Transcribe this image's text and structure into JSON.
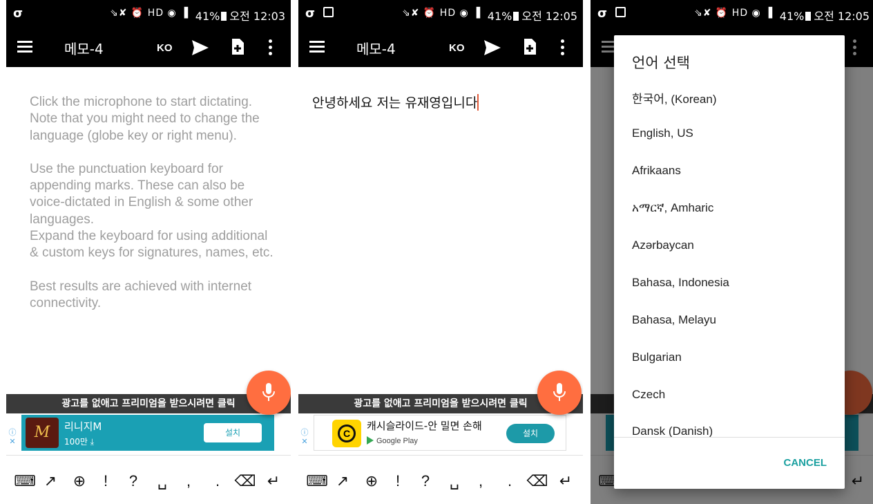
{
  "status_bar": {
    "icons": "⇘✘ ⏰ HD ◉ ▐",
    "battery": "41%",
    "time_1": "오전 12:03",
    "time_2": "오전 12:05",
    "time_3": "오전 12:05"
  },
  "toolbar": {
    "title": "메모-4",
    "lang_code": "KO"
  },
  "screen1": {
    "hint_paragraphs": [
      "Click the microphone to start dictating.\nNote that you might need to change the language (globe key or right menu).",
      "Use the punctuation keyboard for appending marks. These can also be voice-dictated in English & some other languages.\nExpand the keyboard for using additional & custom keys for signatures, names, etc.",
      "Best results are achieved with internet connectivity."
    ]
  },
  "screen2": {
    "dictated_text": "안녕하세요 저는 유재영입니다"
  },
  "ad": {
    "banner_text": "광고를 없애고 프리미엄을 받으시려면 클릭",
    "ad1_name": "리니지M",
    "ad1_sub": "100만 ⤓",
    "ad1_install": "설치",
    "ad1_logo": "M",
    "ad2_name": "캐시슬라이드-안 밀면 손해",
    "ad2_sub": "Google Play",
    "ad2_install": "설치",
    "ad2_logo": "C"
  },
  "keyboard": {
    "keys": [
      "⌨",
      "↗",
      "⊕",
      "!",
      "?",
      "␣",
      ",",
      ".",
      "⌫",
      "↵"
    ]
  },
  "dialog": {
    "title": "언어 선택",
    "languages": [
      "한국어, (Korean)",
      "English, US",
      "Afrikaans",
      "አማርኛ, Amharic",
      "Azərbaycan",
      "Bahasa, Indonesia",
      "Bahasa, Melayu",
      "Bulgarian",
      "Czech",
      "Dansk (Danish)"
    ],
    "cancel": "CANCEL"
  },
  "colors": {
    "accent": "#ff6e40",
    "teal": "#1aa0a0",
    "toolbar": "#000000"
  }
}
